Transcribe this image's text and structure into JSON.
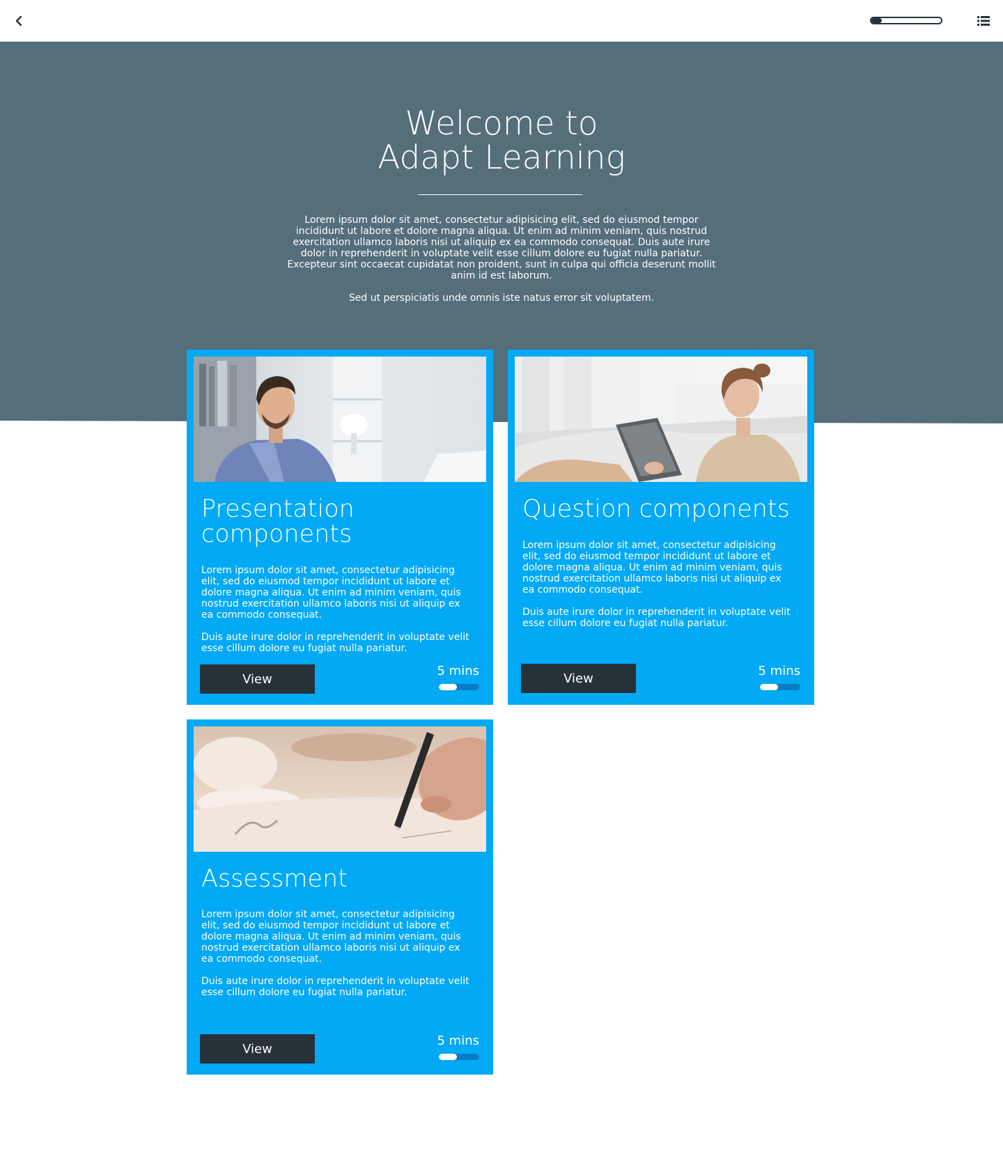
{
  "navbar": {
    "back_icon": "chevron-left-icon",
    "menu_icon": "list-icon",
    "progress": 0.15
  },
  "hero": {
    "title_line1": "Welcome to",
    "title_line2": "Adapt Learning",
    "body_p1": "Lorem ipsum dolor sit amet, consectetur adipisicing elit, sed do eiusmod tempor incididunt ut labore et dolore magna aliqua. Ut enim ad minim veniam, quis nostrud exercitation ullamco laboris nisi ut aliquip ex ea commodo consequat. Duis aute irure dolor in reprehenderit in voluptate velit esse cillum dolore eu fugiat nulla pariatur. Excepteur sint occaecat cupidatat non proident, sunt in culpa qui officia deserunt mollit anim id est laborum.",
    "body_p2": "Sed ut perspiciatis unde omnis iste natus error sit voluptatem."
  },
  "colors": {
    "hero_bg": "#546e7a",
    "card_bg": "#03a9f4",
    "button_bg": "#263238",
    "text": "#ffffff"
  },
  "cards": [
    {
      "title": "Presentation components",
      "body_p1": "Lorem ipsum dolor sit amet, consectetur adipisicing elit, sed do eiusmod tempor incididunt ut labore et dolore magna aliqua. Ut enim ad minim veniam, quis nostrud exercitation ullamco laboris nisi ut aliquip ex ea commodo consequat.",
      "body_p2": "Duis aute irure dolor in reprehenderit in voluptate velit esse cillum dolore eu fugiat nulla pariatur.",
      "button_label": "View",
      "duration": "5 mins",
      "progress": 0.45
    },
    {
      "title": "Question components",
      "body_p1": "Lorem ipsum dolor sit amet, consectetur adipisicing elit, sed do eiusmod tempor incididunt ut labore et dolore magna aliqua. Ut enim ad minim veniam, quis nostrud exercitation ullamco laboris nisi ut aliquip ex ea commodo consequat.",
      "body_p2": "Duis aute irure dolor in reprehenderit in voluptate velit esse cillum dolore eu fugiat nulla pariatur.",
      "button_label": "View",
      "duration": "5 mins",
      "progress": 0.45
    },
    {
      "title": "Assessment",
      "body_p1": "Lorem ipsum dolor sit amet, consectetur adipisicing elit, sed do eiusmod tempor incididunt ut labore et dolore magna aliqua. Ut enim ad minim veniam, quis nostrud exercitation ullamco laboris nisi ut aliquip ex ea commodo consequat.",
      "body_p2": "Duis aute irure dolor in reprehenderit in voluptate velit esse cillum dolore eu fugiat nulla pariatur.",
      "button_label": "View",
      "duration": "5 mins",
      "progress": 0.45
    }
  ]
}
